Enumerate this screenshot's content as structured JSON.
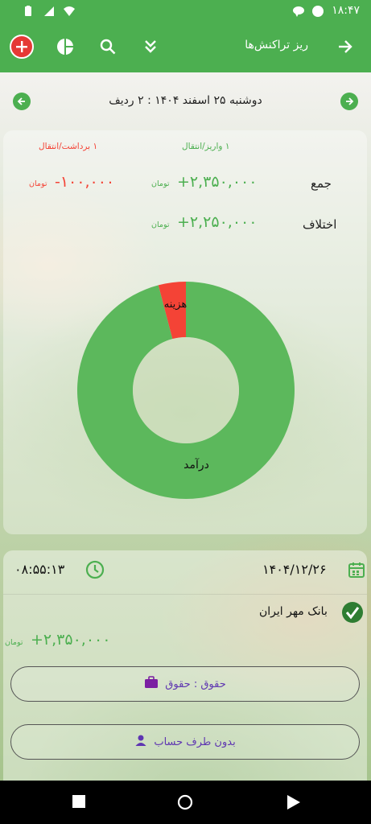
{
  "status_bar": {
    "time": "۱۸:۴۷"
  },
  "app_bar": {
    "title": "ریز تراکنش‌ها",
    "icons": [
      "add-icon",
      "pie-chart-icon",
      "search-icon",
      "double-chevron-down-icon",
      "arrow-forward-icon"
    ]
  },
  "date_nav": {
    "label": "دوشنبه ۲۵ اسفند ۱۴۰۴ : ۲ ردیف"
  },
  "summary": {
    "deposit_count_label": "۱ واریز/انتقال",
    "withdraw_count_label": "۱ برداشت/انتقال",
    "total_label": "جمع",
    "total_income": "+۲,۳۵۰,۰۰۰",
    "total_expense": "-۱۰۰,۰۰۰",
    "difference_label": "اختلاف",
    "difference_value": "+۲,۲۵۰,۰۰۰",
    "unit": "تومان"
  },
  "chart_data": {
    "type": "pie",
    "donut": true,
    "categories": [
      "درآمد",
      "هزینه"
    ],
    "values": [
      2350000,
      100000
    ],
    "colors": [
      "#5cb85c",
      "#f44336"
    ]
  },
  "transaction": {
    "date": "۱۴۰۴/۱۲/۲۶",
    "time": "۰۸:۵۵:۱۳",
    "bank": "بانک مهر ایران",
    "amount": "+۲,۳۵۰,۰۰۰",
    "unit": "تومان",
    "category": "حقوق : حقوق",
    "account_party": "بدون طرف حساب"
  },
  "colors": {
    "primary": "#4caf50",
    "income": "#4caf50",
    "expense": "#f44336",
    "accent_purple": "#7b1fa2"
  }
}
